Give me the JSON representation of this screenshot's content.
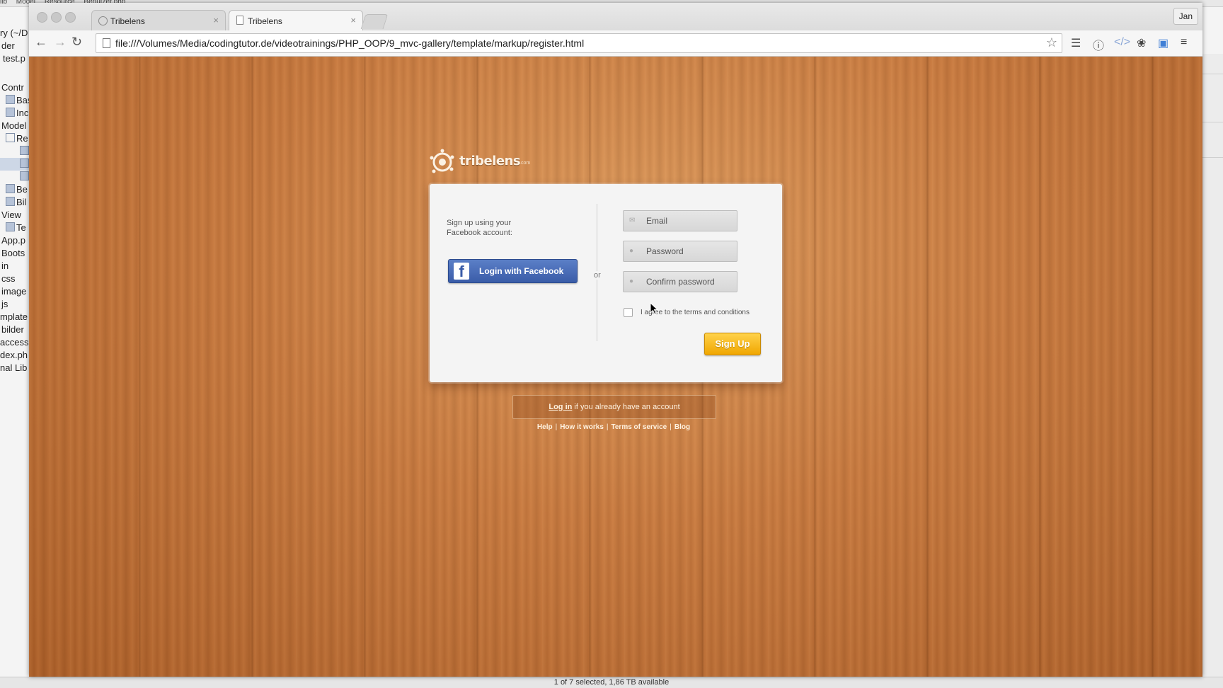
{
  "finder": {
    "topbar": [
      "lib",
      "Model",
      "Resource",
      "Benutzer.php"
    ],
    "sidebar": [
      "ry (~/D",
      "der",
      "test.p",
      "Contr",
      "Bas",
      "Inc",
      "Model",
      "Re",
      "",
      "",
      "",
      "Be",
      "Bil",
      "View",
      "Te",
      "App.p",
      "Boots",
      "in",
      "css",
      "image",
      "js",
      "mplate",
      "bilder",
      "access",
      "dex.ph",
      "nal Lib"
    ],
    "status": "1 of 7 selected, 1,86 TB available"
  },
  "browser": {
    "tabs": [
      {
        "title": "Tribelens",
        "active": false
      },
      {
        "title": "Tribelens",
        "active": true
      }
    ],
    "tab_close": "×",
    "profile": "Jan",
    "url": "file:///Volumes/Media/codingtutor.de/videotrainings/PHP_OOP/9_mvc-gallery/template/markup/register.html",
    "icons": [
      "back-icon",
      "forward-icon",
      "reload-icon",
      "star-icon",
      "layers-icon",
      "info-icon",
      "code-icon",
      "bird-icon",
      "panel-icon",
      "menu-icon"
    ]
  },
  "page": {
    "logo": {
      "word": "tribelens",
      "tld": ".com"
    },
    "facebook": {
      "intro": "Sign up using your Facebook account:",
      "button_label": "Login with Facebook",
      "icon_glyph": "f"
    },
    "or_label": "or",
    "form": {
      "email_placeholder": "Email",
      "password_placeholder": "Password",
      "confirm_placeholder": "Confirm password",
      "agree_label": "I agree to the terms and conditions",
      "submit_label": "Sign Up"
    },
    "login_prompt": {
      "link": "Log in",
      "rest": " if you already have an account"
    },
    "footer": [
      "Help",
      "How it works",
      "Terms of service",
      "Blog"
    ],
    "footer_sep": "|"
  },
  "colors": {
    "wood": "#c97a3f",
    "facebook": "#3a5ca8",
    "signup": "#f0a600"
  }
}
